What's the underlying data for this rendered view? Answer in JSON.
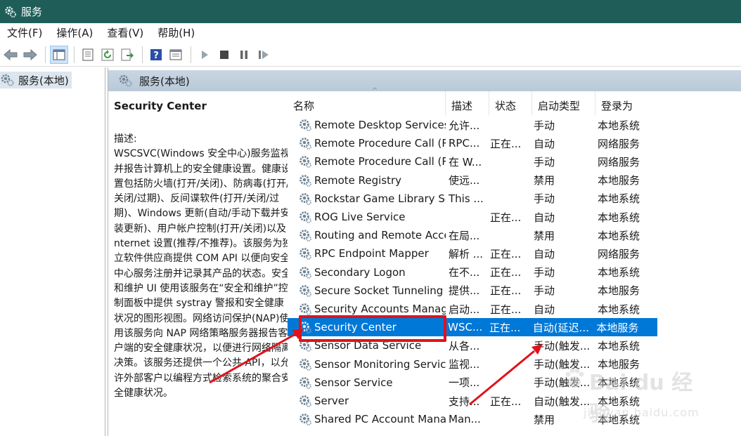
{
  "window": {
    "title": "服务"
  },
  "menu": [
    "文件(F)",
    "操作(A)",
    "查看(V)",
    "帮助(H)"
  ],
  "toolbar": {
    "icons": [
      "back-icon",
      "forward-icon",
      "console-tree-icon",
      "properties-icon",
      "refresh-icon",
      "export-icon",
      "help-icon",
      "view-icon",
      "play-icon",
      "stop-icon",
      "pause-icon",
      "restart-icon"
    ]
  },
  "tree": {
    "root": "服务(本地)"
  },
  "pane": {
    "header": "服务(本地)"
  },
  "description": {
    "name": "Security Center",
    "label": "描述:",
    "text": "WSCSVC(Windows 安全中心)服务监视并报告计算机上的安全健康设置。健康设置包括防火墙(打开/关闭)、防病毒(打开/关闭/过期)、反间谍软件(打开/关闭/过期)、Windows 更新(自动/手动下载并安装更新)、用户帐户控制(打开/关闭)以及 Internet 设置(推荐/不推荐)。该服务为独立软件供应商提供 COM API 以便向安全中心服务注册并记录其产品的状态。安全和维护 UI 使用该服务在“安全和维护”控制面板中提供 systray 警报和安全健康状况的图形视图。网络访问保护(NAP)使用该服务向 NAP 网络策略服务器报告客户端的安全健康状况，以便进行网络隔离决策。该服务还提供一个公共 API，以允许外部客户以编程方式检索系统的聚合安全健康状况。"
  },
  "columns": [
    "名称",
    "描述",
    "状态",
    "启动类型",
    "登录为"
  ],
  "services": [
    {
      "name": "Remote Desktop Services ...",
      "desc": "允许...",
      "status": "",
      "start": "手动",
      "logon": "本地系统"
    },
    {
      "name": "Remote Procedure Call (R...",
      "desc": "RPC...",
      "status": "正在...",
      "start": "自动",
      "logon": "网络服务"
    },
    {
      "name": "Remote Procedure Call (R...",
      "desc": "在 W...",
      "status": "",
      "start": "手动",
      "logon": "网络服务"
    },
    {
      "name": "Remote Registry",
      "desc": "使远...",
      "status": "",
      "start": "禁用",
      "logon": "本地服务"
    },
    {
      "name": "Rockstar Game Library Ser...",
      "desc": "This ...",
      "status": "",
      "start": "手动",
      "logon": "本地系统"
    },
    {
      "name": "ROG Live Service",
      "desc": "",
      "status": "正在...",
      "start": "自动",
      "logon": "本地系统"
    },
    {
      "name": "Routing and Remote Access",
      "desc": "在局...",
      "status": "",
      "start": "禁用",
      "logon": "本地系统"
    },
    {
      "name": "RPC Endpoint Mapper",
      "desc": "解析 ...",
      "status": "正在...",
      "start": "自动",
      "logon": "网络服务"
    },
    {
      "name": "Secondary Logon",
      "desc": "在不...",
      "status": "正在...",
      "start": "手动",
      "logon": "本地系统"
    },
    {
      "name": "Secure Socket Tunneling P...",
      "desc": "提供...",
      "status": "正在...",
      "start": "手动",
      "logon": "本地服务"
    },
    {
      "name": "Security Accounts Manager",
      "desc": "启动...",
      "status": "正在...",
      "start": "自动",
      "logon": "本地系统"
    },
    {
      "name": "Security Center",
      "desc": "WSC...",
      "status": "正在...",
      "start": "自动(延迟...",
      "logon": "本地服务"
    },
    {
      "name": "Sensor Data Service",
      "desc": "从各...",
      "status": "",
      "start": "手动(触发...",
      "logon": "本地系统"
    },
    {
      "name": "Sensor Monitoring Service",
      "desc": "监视...",
      "status": "",
      "start": "手动(触发...",
      "logon": "本地服务"
    },
    {
      "name": "Sensor Service",
      "desc": "一项...",
      "status": "",
      "start": "手动(触发...",
      "logon": "本地系统"
    },
    {
      "name": "Server",
      "desc": "支持...",
      "status": "正在...",
      "start": "自动(触发...",
      "logon": "本地系统"
    },
    {
      "name": "Shared PC Account Manager",
      "desc": "Man...",
      "status": "",
      "start": "禁用",
      "logon": "本地系统"
    }
  ],
  "selected_index": 11,
  "watermark": {
    "text": "Bai du 经验",
    "sub": "jingyan.baidu.com"
  },
  "colors": {
    "titlebar": "#1f5e58",
    "selection": "#0078d7",
    "annotation": "#e0121b"
  }
}
